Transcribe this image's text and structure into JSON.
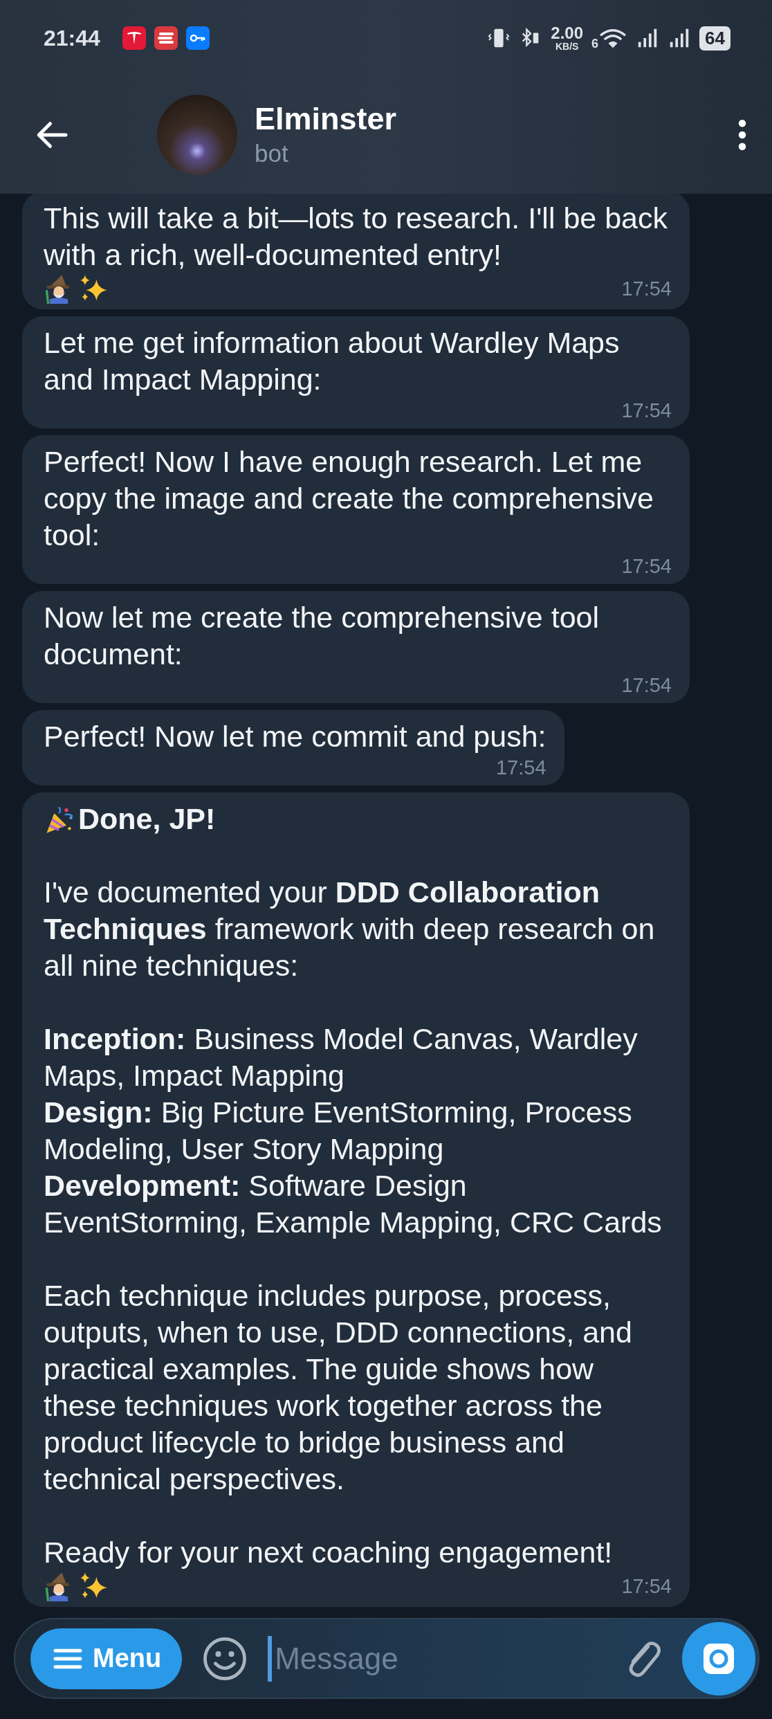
{
  "status_bar": {
    "time": "21:44",
    "speed_value": "2.00",
    "speed_unit": "KB/S",
    "wifi_standard": "6",
    "battery": "64"
  },
  "header": {
    "title": "Elminster",
    "subtitle": "bot"
  },
  "messages": [
    {
      "kind": "signoff",
      "paragraphs": [
        [
          "This will take a bit—lots to research. I'll be back with a rich, well-documented entry!"
        ]
      ],
      "time": "17:54"
    },
    {
      "kind": "plain",
      "paragraphs": [
        [
          "Let me get information about Wardley Maps and Impact Mapping:"
        ]
      ],
      "time": "17:54"
    },
    {
      "kind": "plain",
      "paragraphs": [
        [
          "Perfect! Now I have enough research. Let me copy the image and create the comprehensive tool:"
        ]
      ],
      "time": "17:54"
    },
    {
      "kind": "plain",
      "paragraphs": [
        [
          "Now let me create the comprehensive tool document:"
        ]
      ],
      "time": "17:54"
    },
    {
      "kind": "plain",
      "paragraphs": [
        [
          "Perfect! Now let me commit and push:"
        ]
      ],
      "time": "17:54"
    },
    {
      "kind": "signoff",
      "title": "Done, JP!",
      "paragraphs": [
        [
          "I've documented your **DDD Collaboration Techniques** framework with deep research on all nine techniques:"
        ],
        [
          "**Inception:** Business Model Canvas, Wardley Maps, Impact Mapping",
          "**Design:** Big Picture EventStorming, Process Modeling, User Story Mapping",
          "**Development:** Software Design EventStorming, Example Mapping, CRC Cards"
        ],
        [
          "Each technique includes purpose, process, outputs, when to use, DDD connections, and practical examples. The guide shows how these techniques work together across the product lifecycle to bridge business and technical perspectives."
        ],
        [
          "Ready for your next coaching engagement!"
        ]
      ],
      "time": "17:54"
    }
  ],
  "composer": {
    "menu_label": "Menu",
    "placeholder": "Message"
  }
}
